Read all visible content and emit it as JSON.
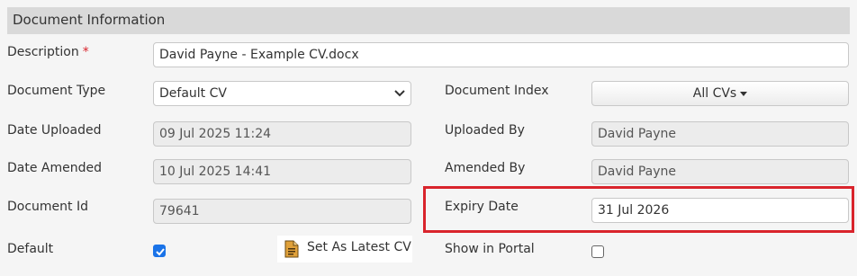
{
  "section": {
    "title": "Document Information"
  },
  "fields": {
    "description": {
      "label": "Description",
      "required_mark": "*",
      "value": "David Payne - Example CV.docx"
    },
    "document_type": {
      "label": "Document Type",
      "value": "Default CV"
    },
    "document_index": {
      "label": "Document Index",
      "value": "All CVs"
    },
    "date_uploaded": {
      "label": "Date Uploaded",
      "value": "09 Jul 2025 11:24"
    },
    "uploaded_by": {
      "label": "Uploaded By",
      "value": "David Payne"
    },
    "date_amended": {
      "label": "Date Amended",
      "value": "10 Jul 2025 14:41"
    },
    "amended_by": {
      "label": "Amended By",
      "value": "David Payne"
    },
    "document_id": {
      "label": "Document Id",
      "value": "79641"
    },
    "expiry_date": {
      "label": "Expiry Date",
      "value": "31 Jul 2026"
    },
    "default": {
      "label": "Default",
      "checked": true
    },
    "show_in_portal": {
      "label": "Show in Portal",
      "checked": false
    }
  },
  "actions": {
    "set_latest": "Set As Latest CV"
  },
  "icons": {
    "dropdown": "chevron-down-icon",
    "caret": "caret-down-icon",
    "document": "document-icon",
    "check": "checkmark-icon"
  },
  "colors": {
    "header_bg": "#d9d9d9",
    "highlight": "#d9242c",
    "checkbox_accent": "#1a73e8",
    "required": "#d9242c",
    "doc_icon": "#e0a13a"
  }
}
